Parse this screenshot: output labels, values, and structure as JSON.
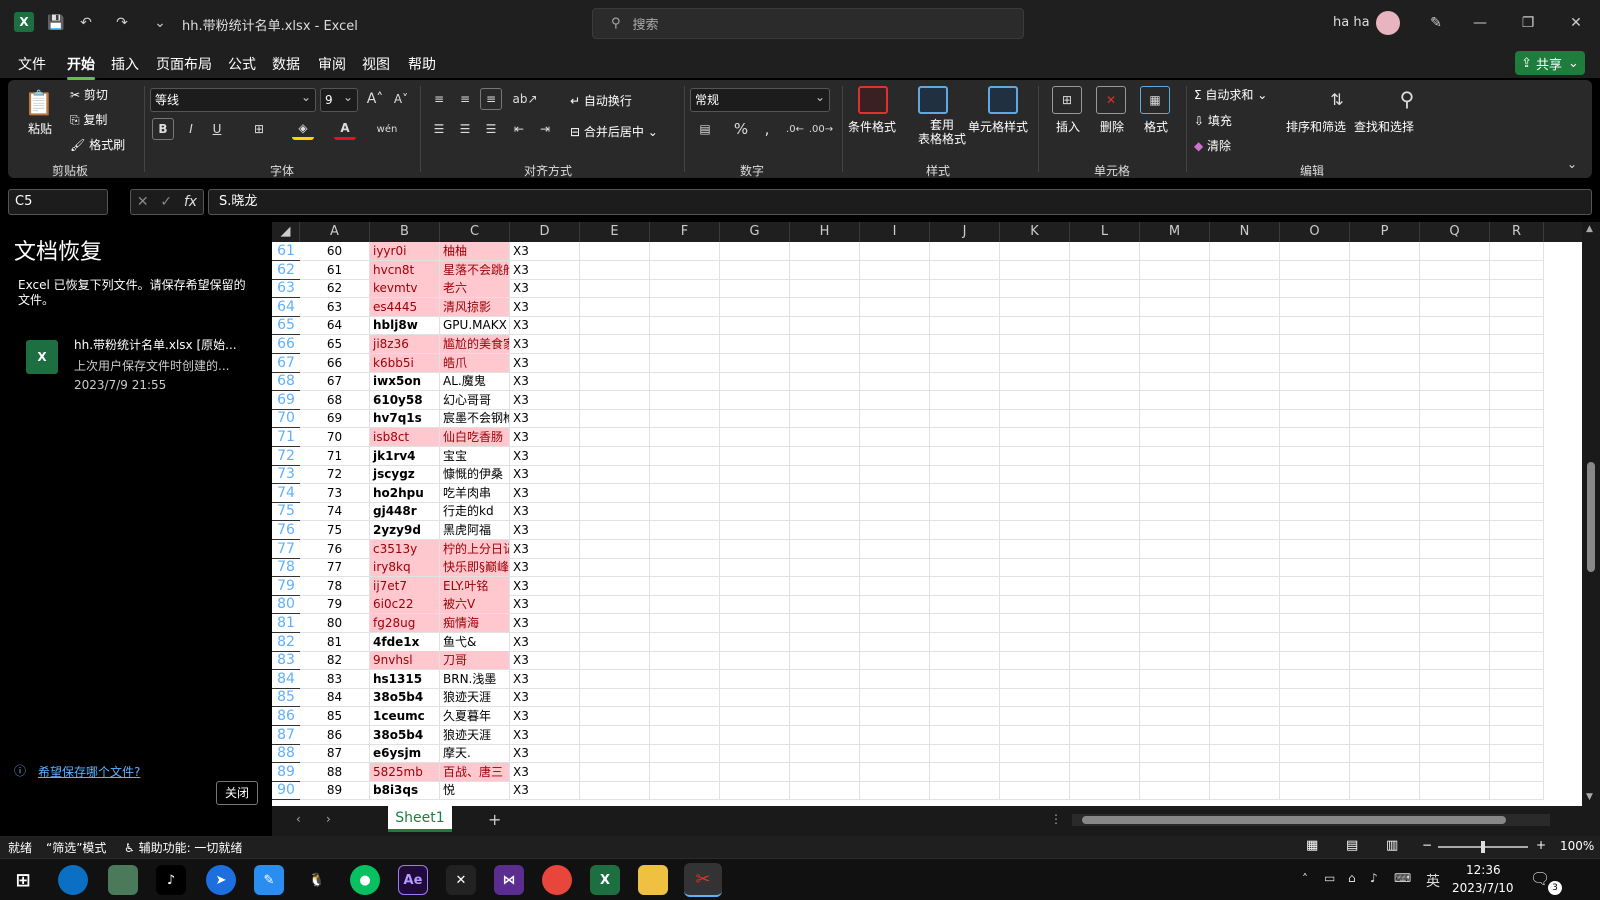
{
  "window": {
    "title": "hh.带粉统计名单.xlsx - Excel",
    "search_placeholder": "搜索",
    "user": "ha ha"
  },
  "menu": [
    "文件",
    "开始",
    "插入",
    "页面布局",
    "公式",
    "数据",
    "审阅",
    "视图",
    "帮助"
  ],
  "share_label": "共享",
  "ribbon": {
    "clipboard": {
      "paste": "粘贴",
      "cut": "剪切",
      "copy": "复制",
      "format_painter": "格式刷",
      "label": "剪贴板"
    },
    "font": {
      "name": "等线",
      "size": "9",
      "label": "字体"
    },
    "alignment": {
      "wrap": "自动换行",
      "merge": "合并后居中",
      "label": "对齐方式"
    },
    "number": {
      "format": "常规",
      "label": "数字"
    },
    "styles": {
      "conditional": "条件格式",
      "table": "套用\n表格格式",
      "cell_styles": "单元格样式",
      "label": "样式"
    },
    "cells": {
      "insert": "插入",
      "delete": "删除",
      "format": "格式",
      "label": "单元格"
    },
    "editing": {
      "autosum": "自动求和",
      "fill": "填充",
      "clear": "清除",
      "sort": "排序和筛选",
      "find": "查找和选择",
      "label": "编辑"
    }
  },
  "formula_bar": {
    "name_box": "C5",
    "content": "S.晓龙"
  },
  "recovery": {
    "title": "文档恢复",
    "message": "Excel 已恢复下列文件。请保存希望保留的文件。",
    "file_name": "hh.带粉统计名单.xlsx  [原始...",
    "file_desc": "上次用户保存文件时创建的...",
    "file_time": "2023/7/9 21:55",
    "help_link": "希望保存哪个文件?",
    "close": "关闭"
  },
  "columns": [
    "A",
    "B",
    "C",
    "D",
    "E",
    "F",
    "G",
    "H",
    "I",
    "J",
    "K",
    "L",
    "M",
    "N",
    "O",
    "P",
    "Q",
    "R"
  ],
  "rows": [
    {
      "r": "61",
      "a": "60",
      "b": "iyyr0i",
      "c": "柚柚",
      "d": "X3",
      "pink": true
    },
    {
      "r": "62",
      "a": "61",
      "b": "hvcn8t",
      "c": "星落不会跳舱",
      "d": "X3",
      "pink": true
    },
    {
      "r": "63",
      "a": "62",
      "b": "kevmtv",
      "c": "老六",
      "d": "X3",
      "pink": true
    },
    {
      "r": "64",
      "a": "63",
      "b": "es4445",
      "c": "清风掠影",
      "d": "X3",
      "pink": true
    },
    {
      "r": "65",
      "a": "64",
      "b": "hblj8w",
      "c": "GPU.MAKX",
      "d": "X3",
      "pink": false
    },
    {
      "r": "66",
      "a": "65",
      "b": "ji8z36",
      "c": "尴尬的美食家",
      "d": "X3",
      "pink": true
    },
    {
      "r": "67",
      "a": "66",
      "b": "k6bb5i",
      "c": "皓爪",
      "d": "X3",
      "pink": true
    },
    {
      "r": "68",
      "a": "67",
      "b": "iwx5on",
      "c": "AL.魔鬼",
      "d": "X3",
      "pink": false
    },
    {
      "r": "69",
      "a": "68",
      "b": "610y58",
      "c": "幻心哥哥",
      "d": "X3",
      "pink": false
    },
    {
      "r": "70",
      "a": "69",
      "b": "hv7q1s",
      "c": "宸墨不会钢枪",
      "d": "X3",
      "pink": false
    },
    {
      "r": "71",
      "a": "70",
      "b": "isb8ct",
      "c": "仙白吃香肠",
      "d": "X3",
      "pink": true
    },
    {
      "r": "72",
      "a": "71",
      "b": "jk1rv4",
      "c": "宝宝",
      "d": "X3",
      "pink": false
    },
    {
      "r": "73",
      "a": "72",
      "b": "jscygz",
      "c": "慷慨的伊桑",
      "d": "X3",
      "pink": false
    },
    {
      "r": "74",
      "a": "73",
      "b": "ho2hpu",
      "c": "吃羊肉串",
      "d": "X3",
      "pink": false
    },
    {
      "r": "75",
      "a": "74",
      "b": "gj448r",
      "c": "行走的kd",
      "d": "X3",
      "pink": false
    },
    {
      "r": "76",
      "a": "75",
      "b": "2yzy9d",
      "c": "黑虎阿福",
      "d": "X3",
      "pink": false
    },
    {
      "r": "77",
      "a": "76",
      "b": "c3513y",
      "c": "柠的上分日记",
      "d": "X3",
      "pink": true
    },
    {
      "r": "78",
      "a": "77",
      "b": "iry8kq",
      "c": "快乐即§巅峰",
      "d": "X3",
      "pink": true
    },
    {
      "r": "79",
      "a": "78",
      "b": "ij7et7",
      "c": "ELY.叶铭",
      "d": "X3",
      "pink": true
    },
    {
      "r": "80",
      "a": "79",
      "b": "6i0c22",
      "c": "被六V",
      "d": "X3",
      "pink": true
    },
    {
      "r": "81",
      "a": "80",
      "b": "fg28ug",
      "c": "痴情海",
      "d": "X3",
      "pink": true
    },
    {
      "r": "82",
      "a": "81",
      "b": "4fde1x",
      "c": "鱼弋&",
      "d": "X3",
      "pink": false
    },
    {
      "r": "83",
      "a": "82",
      "b": "9nvhsl",
      "c": "刀哥",
      "d": "X3",
      "pink": true
    },
    {
      "r": "84",
      "a": "83",
      "b": "hs1315",
      "c": "BRN.浅墨",
      "d": "X3",
      "pink": false
    },
    {
      "r": "85",
      "a": "84",
      "b": "38o5b4",
      "c": "狼迹天涯",
      "d": "X3",
      "pink": false
    },
    {
      "r": "86",
      "a": "85",
      "b": "1ceumc",
      "c": "久夏暮年",
      "d": "X3",
      "pink": false
    },
    {
      "r": "87",
      "a": "86",
      "b": "38o5b4",
      "c": "狼迹天涯",
      "d": "X3",
      "pink": false
    },
    {
      "r": "88",
      "a": "87",
      "b": "e6ysjm",
      "c": "摩天.",
      "d": "X3",
      "pink": false
    },
    {
      "r": "89",
      "a": "88",
      "b": "5825mb",
      "c": "百战、唐三",
      "d": "X3",
      "pink": true
    },
    {
      "r": "90",
      "a": "89",
      "b": "b8i3qs",
      "c": "悦",
      "d": "X3",
      "pink": false
    }
  ],
  "sheet_tab": "Sheet1",
  "status": {
    "ready": "就绪",
    "filter": "“筛选”模式",
    "accessibility": "辅助功能: 一切就绪",
    "zoom": "100%"
  },
  "taskbar": {
    "time": "12:36",
    "date": "2023/7/10",
    "ime": "英",
    "notif_count": "3"
  },
  "colors": {
    "accent": "#6cbd45",
    "pink_fill": "#ffc7ce",
    "pink_text": "#9c0006",
    "row_header": "#5fb0ff"
  }
}
